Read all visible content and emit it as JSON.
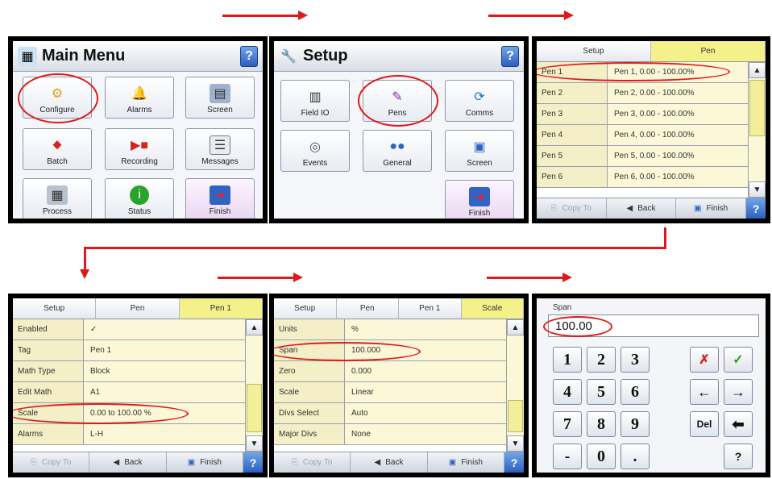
{
  "colors": {
    "accent_red": "#e01818",
    "row_yellow": "#f4efc6",
    "crumb_active": "#f4f08a",
    "help_blue": "#2b5fc1"
  },
  "main_menu": {
    "title": "Main Menu",
    "help": "?",
    "buttons": [
      {
        "label": "Configure",
        "icon": "gear-icon"
      },
      {
        "label": "Alarms",
        "icon": "bell-icon"
      },
      {
        "label": "Screen",
        "icon": "screen-icon"
      },
      {
        "label": "Batch",
        "icon": "batch-icon"
      },
      {
        "label": "Recording",
        "icon": "recording-icon"
      },
      {
        "label": "Messages",
        "icon": "messages-icon"
      },
      {
        "label": "Process",
        "icon": "calculator-icon"
      },
      {
        "label": "Status",
        "icon": "info-icon"
      },
      {
        "label": "Finish",
        "icon": "exit-icon"
      }
    ]
  },
  "setup_menu": {
    "title": "Setup",
    "help": "?",
    "buttons": [
      {
        "label": "Field IO",
        "icon": "field-io-icon"
      },
      {
        "label": "Pens",
        "icon": "pens-icon"
      },
      {
        "label": "Comms",
        "icon": "comms-icon"
      },
      {
        "label": "Events",
        "icon": "events-icon"
      },
      {
        "label": "General",
        "icon": "general-icon"
      },
      {
        "label": "Screen",
        "icon": "screen-icon"
      },
      {
        "label": "Finish",
        "icon": "exit-icon"
      }
    ]
  },
  "pen_list": {
    "crumbs": [
      "Setup",
      "Pen"
    ],
    "rows": [
      {
        "k": "Pen 1",
        "v": "Pen 1, 0.00 - 100.00%"
      },
      {
        "k": "Pen 2",
        "v": "Pen 2, 0.00 - 100.00%"
      },
      {
        "k": "Pen 3",
        "v": "Pen 3, 0.00 - 100.00%"
      },
      {
        "k": "Pen 4",
        "v": "Pen 4, 0.00 - 100.00%"
      },
      {
        "k": "Pen 5",
        "v": "Pen 5, 0.00 - 100.00%"
      },
      {
        "k": "Pen 6",
        "v": "Pen 6, 0.00 - 100.00%"
      }
    ],
    "bottom": {
      "copy": "Copy To",
      "back": "Back",
      "finish": "Finish",
      "help": "?"
    }
  },
  "pen1": {
    "crumbs": [
      "Setup",
      "Pen",
      "Pen 1"
    ],
    "rows": [
      {
        "k": "Enabled",
        "v": "✓"
      },
      {
        "k": "Tag",
        "v": "Pen 1"
      },
      {
        "k": "Math Type",
        "v": "Block"
      },
      {
        "k": "Edit Math",
        "v": "A1"
      },
      {
        "k": "Scale",
        "v": "0.00 to 100.00 %"
      },
      {
        "k": "Alarms",
        "v": "L-H"
      }
    ],
    "bottom": {
      "copy": "Copy To",
      "back": "Back",
      "finish": "Finish",
      "help": "?"
    }
  },
  "scale": {
    "crumbs": [
      "Setup",
      "Pen",
      "Pen 1",
      "Scale"
    ],
    "rows": [
      {
        "k": "Units",
        "v": "%"
      },
      {
        "k": "Span",
        "v": "100.000"
      },
      {
        "k": "Zero",
        "v": "0.000"
      },
      {
        "k": "Scale",
        "v": "Linear"
      },
      {
        "k": "Divs Select",
        "v": "Auto"
      },
      {
        "k": "Major Divs",
        "v": "None"
      }
    ],
    "bottom": {
      "copy": "Copy To",
      "back": "Back",
      "finish": "Finish",
      "help": "?"
    }
  },
  "span_editor": {
    "label": "Span",
    "value": "100.00",
    "keys": [
      "1",
      "2",
      "3",
      "4",
      "5",
      "6",
      "7",
      "8",
      "9",
      "-",
      "0",
      "."
    ],
    "cancel": "✗",
    "ok": "✓",
    "left": "←",
    "right": "→",
    "del": "Del",
    "backspace": "⬅",
    "help": "?"
  }
}
